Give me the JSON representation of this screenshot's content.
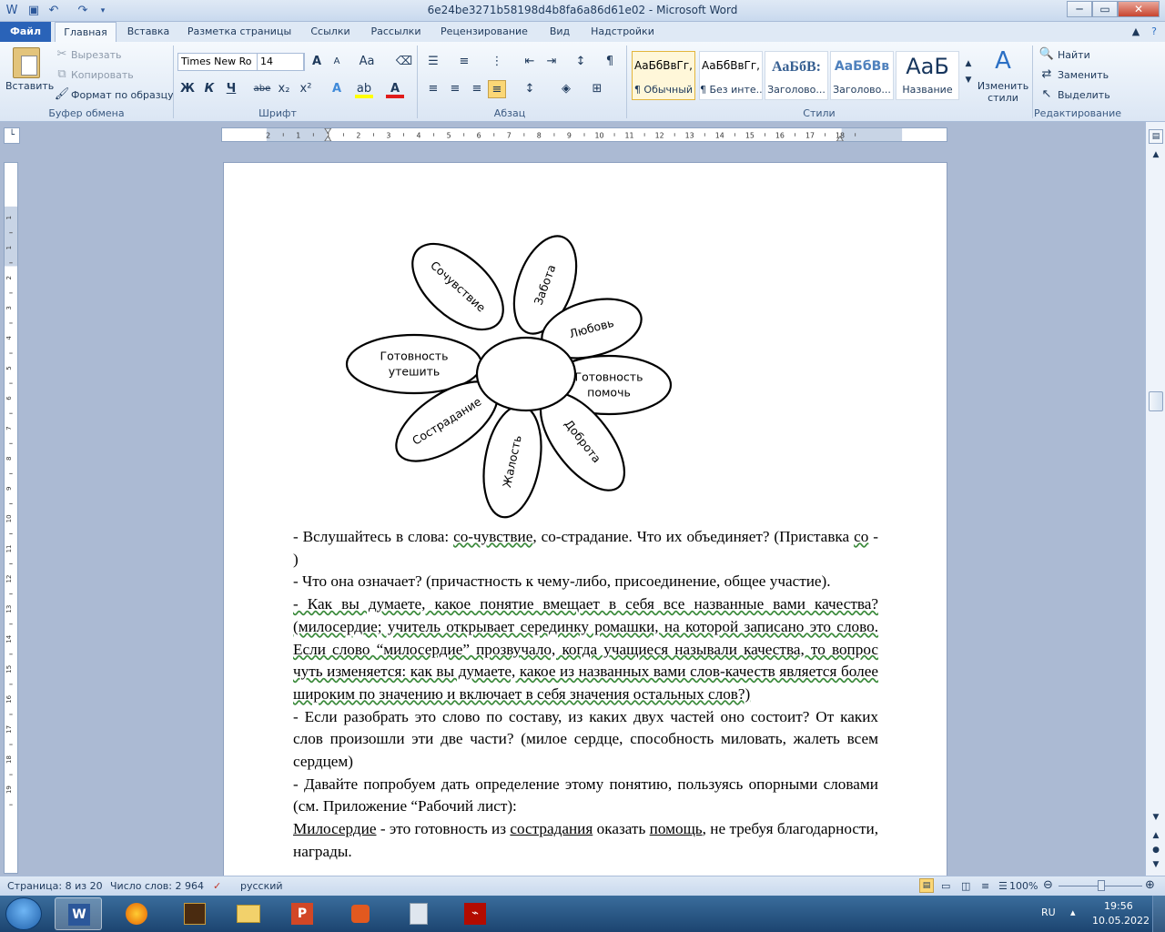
{
  "window": {
    "title": "6e24be3271b58198d4b8fa6a86d61e02 - Microsoft Word",
    "minimize": "─",
    "restore": "▭",
    "close": "✕"
  },
  "tabs": [
    {
      "label": "Файл"
    },
    {
      "label": "Главная"
    },
    {
      "label": "Вставка"
    },
    {
      "label": "Разметка страницы"
    },
    {
      "label": "Ссылки"
    },
    {
      "label": "Рассылки"
    },
    {
      "label": "Рецензирование"
    },
    {
      "label": "Вид"
    },
    {
      "label": "Надстройки"
    }
  ],
  "clipboard": {
    "paste": "Вставить",
    "cut": "Вырезать",
    "copy": "Копировать",
    "format_painter": "Формат по образцу",
    "group": "Буфер обмена"
  },
  "font": {
    "name": "Times New Ro",
    "size": "14",
    "group": "Шрифт",
    "bold": "Ж",
    "italic": "К",
    "underline": "Ч",
    "strike": "abe",
    "sub": "x₂",
    "sup": "x²",
    "grow": "A",
    "shrink": "A",
    "case": "Aa"
  },
  "paragraph": {
    "group": "Абзац"
  },
  "styles": {
    "group": "Стили",
    "items": [
      {
        "sample": "АаБбВвГг,",
        "name": "¶ Обычный"
      },
      {
        "sample": "АаБбВвГг,",
        "name": "¶ Без инте..."
      },
      {
        "sample": "АаБбВ:",
        "name": "Заголово..."
      },
      {
        "sample": "АаБбВв",
        "name": "Заголово..."
      },
      {
        "sample": "АаБ",
        "name": "Название"
      }
    ],
    "change": "Изменить стили"
  },
  "editing": {
    "group": "Редактирование",
    "find": "Найти",
    "replace": "Заменить",
    "select": "Выделить"
  },
  "ruler": {
    "numbers": [
      "2",
      "1",
      "1",
      "2",
      "3",
      "4",
      "5",
      "6",
      "7",
      "8",
      "9",
      "10",
      "11",
      "12",
      "13",
      "14",
      "15",
      "16",
      "17",
      "18"
    ]
  },
  "vruler": {
    "numbers": [
      "1",
      "1",
      "2",
      "3",
      "4",
      "5",
      "6",
      "7",
      "8",
      "9",
      "10",
      "11",
      "12",
      "13",
      "14",
      "15",
      "16",
      "17",
      "18",
      "19"
    ]
  },
  "diagram": {
    "center": "",
    "petals": [
      "Сочувствие",
      "Забота",
      "Любовь",
      "Готовность утешить",
      "Готовность помочь",
      "Сострадание",
      "Жалость",
      "Доброта"
    ]
  },
  "doc": {
    "p1a": "- Вслушайтесь в  слова: ",
    "p1b": "со-чувствие",
    "p1c": ", со-страдание. Что их объединяет? (Приставка ",
    "p1d": "со",
    "p1e": " - )",
    "p2": "- Что она означает? (причастность к чему-либо, присоединение, общее участие).",
    "p3": "- Как вы думаете, какое понятие  вмещает в себя все названные вами  качества? (милосердие; учитель открывает серединку ромашки, на которой записано это слово.  Если  слово “милосердие” прозвучало, когда учащиеся называли качества, то вопрос чуть изменяется: как вы думаете, какое из названных вами слов-качеств является более широким по значению и включает в себя значения остальных слов?)",
    "p4": "- Если разобрать это слово по составу, из каких двух частей оно состоит? От каких слов произошли эти две части? (милое сердце, способность миловать, жалеть всем сердцем)",
    "p5": "- Давайте попробуем дать определение этому понятию, пользуясь опорными словами (см. Приложение “Рабочий лист):",
    "p6a": "Милосердие",
    "p6b": " - это  готовность из ",
    "p6c": "сострадания",
    "p6d": " оказать ",
    "p6e": "помощь",
    "p6f": ", не требуя благодарности, награды."
  },
  "status": {
    "page": "Страница: 8 из 20",
    "words": "Число слов: 2 964",
    "lang": "русский",
    "zoom": "100%"
  },
  "taskbar": {
    "lang": "RU",
    "time": "19:56",
    "date": "10.05.2022"
  }
}
